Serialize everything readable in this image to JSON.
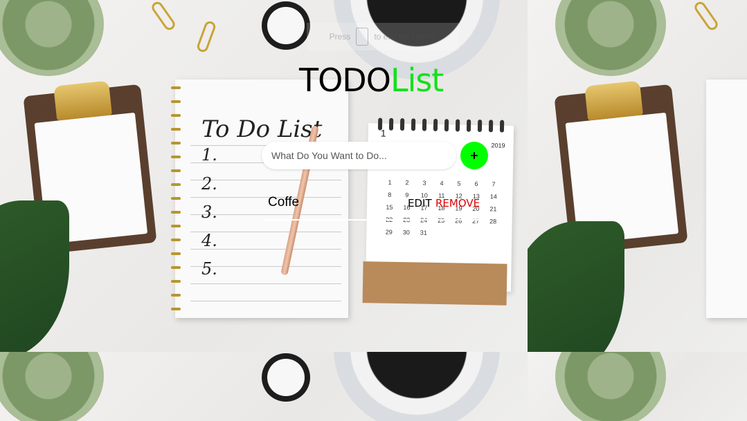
{
  "hint": {
    "left": "Press",
    "right": "to exit full screen"
  },
  "app": {
    "title_part1": "TODO",
    "title_part2": "List",
    "title_colors": {
      "part1": "#000000",
      "part2": "#14e11a"
    }
  },
  "input": {
    "placeholder": "What Do You Want to Do...",
    "value": ""
  },
  "add_button": {
    "icon": "plus-icon",
    "color": "#00ff00"
  },
  "todos": [
    {
      "text": "Coffe",
      "edit_label": "EDIT",
      "remove_label": "REMOVE"
    }
  ],
  "colors": {
    "remove": "#e00000",
    "edit": "#000000"
  },
  "background": {
    "notebook_title": "To Do List",
    "notebook_numbers": [
      "1.",
      "2.",
      "3.",
      "4.",
      "5."
    ],
    "calendar_year": "2019",
    "calendar_month": "1"
  }
}
